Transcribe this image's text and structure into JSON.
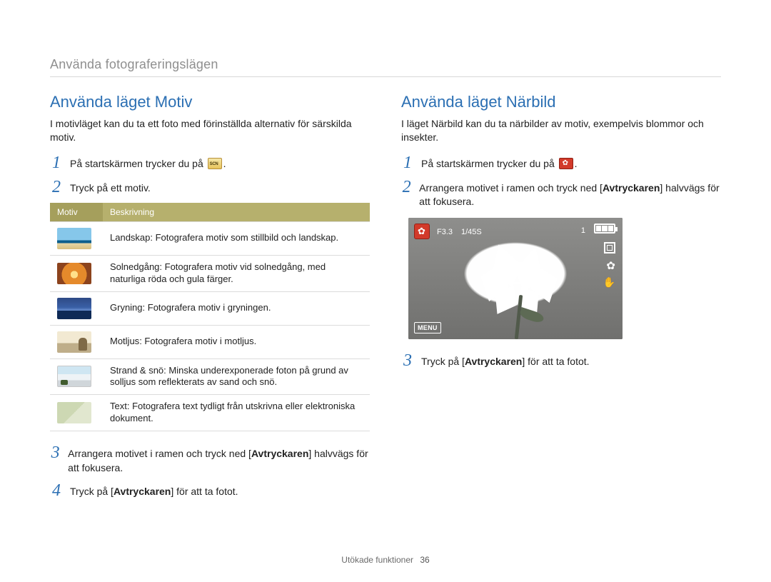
{
  "breadcrumb": "Använda fotograferingslägen",
  "left": {
    "heading": "Använda läget Motiv",
    "intro": "I motivläget kan du ta ett foto med förinställda alternativ för särskilda motiv.",
    "steps": {
      "1": "På startskärmen trycker du på",
      "1_post": ".",
      "2": "Tryck på ett motiv.",
      "3_pre": "Arrangera motivet i ramen och tryck ned [",
      "3_bold": "Avtryckaren",
      "3_post": "] halvvägs för att fokusera.",
      "4_pre": "Tryck på [",
      "4_bold": "Avtryckaren",
      "4_post": "] för att ta fotot."
    },
    "table": {
      "head_motiv": "Motiv",
      "head_beskr": "Beskrivning",
      "rows": [
        {
          "title": "Landskap",
          "desc": ": Fotografera motiv som stillbild och landskap."
        },
        {
          "title": "Solnedgång",
          "desc": ": Fotografera motiv vid solnedgång, med naturliga röda och gula färger."
        },
        {
          "title": "Gryning",
          "desc": ": Fotografera motiv i gryningen."
        },
        {
          "title": "Motljus",
          "desc": ": Fotografera motiv i motljus."
        },
        {
          "title": "Strand & snö",
          "desc": ": Minska underexponerade foton på grund av solljus som reflekterats av sand och snö."
        },
        {
          "title": "Text",
          "desc": ": Fotografera text tydligt från utskrivna eller elektroniska dokument."
        }
      ]
    }
  },
  "right": {
    "heading": "Använda läget Närbild",
    "intro": "I läget Närbild kan du ta närbilder av motiv, exempelvis blommor och insekter.",
    "steps": {
      "1": "På startskärmen trycker du på",
      "1_post": ".",
      "2_pre": "Arrangera motivet i ramen och tryck ned [",
      "2_bold": "Avtryckaren",
      "2_post": "] halvvägs för att fokusera.",
      "3_pre": "Tryck på [",
      "3_bold": "Avtryckaren",
      "3_post": "] för att ta fotot."
    },
    "hud": {
      "f": "F3.3",
      "s": "1/45S",
      "count": "1",
      "menu": "MENU"
    }
  },
  "footer": {
    "label": "Utökade funktioner",
    "page": "36"
  }
}
